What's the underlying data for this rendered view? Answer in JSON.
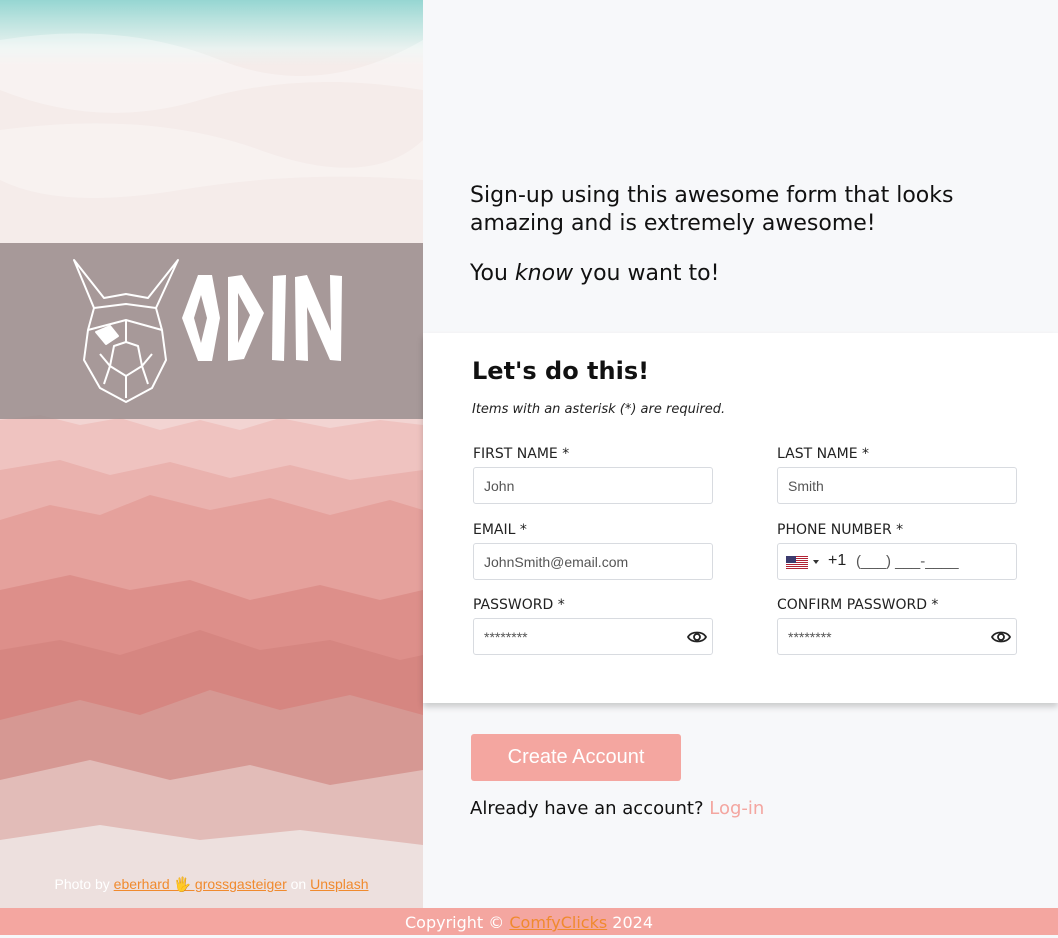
{
  "intro": {
    "line1": "Sign-up using this awesome form that looks amazing and is extremely awesome!",
    "line2_prefix": "You ",
    "line2_em": "know",
    "line2_suffix": " you want to!"
  },
  "logo": {
    "text": "ODIN",
    "icon": "viking-helmet-icon"
  },
  "credit": {
    "prefix": "Photo by ",
    "author": "eberhard 🖐 grossgasteiger",
    "middle": " on ",
    "site": "Unsplash"
  },
  "form": {
    "title": "Let's do this!",
    "note": "Items with an asterisk (*) are required.",
    "fields": {
      "first_name": {
        "label": "FIRST NAME *",
        "placeholder": "John"
      },
      "last_name": {
        "label": "LAST NAME *",
        "placeholder": "Smith"
      },
      "email": {
        "label": "EMAIL *",
        "placeholder": "JohnSmith@email.com"
      },
      "phone": {
        "label": "PHONE NUMBER *",
        "country_code": "+1",
        "placeholder": "(___) ___-____",
        "flag": "us-flag-icon"
      },
      "password": {
        "label": "PASSWORD *",
        "placeholder": "********"
      },
      "confirm_password": {
        "label": "CONFIRM PASSWORD *",
        "placeholder": "********"
      }
    }
  },
  "actions": {
    "create_label": "Create Account",
    "login_prompt": "Already have an account? ",
    "login_link": "Log-in"
  },
  "footer": {
    "prefix": "Copyright © ",
    "brand": "ComfyClicks",
    "year": " 2024"
  },
  "colors": {
    "accent": "#f4a6a0",
    "link": "#f08a2e"
  }
}
